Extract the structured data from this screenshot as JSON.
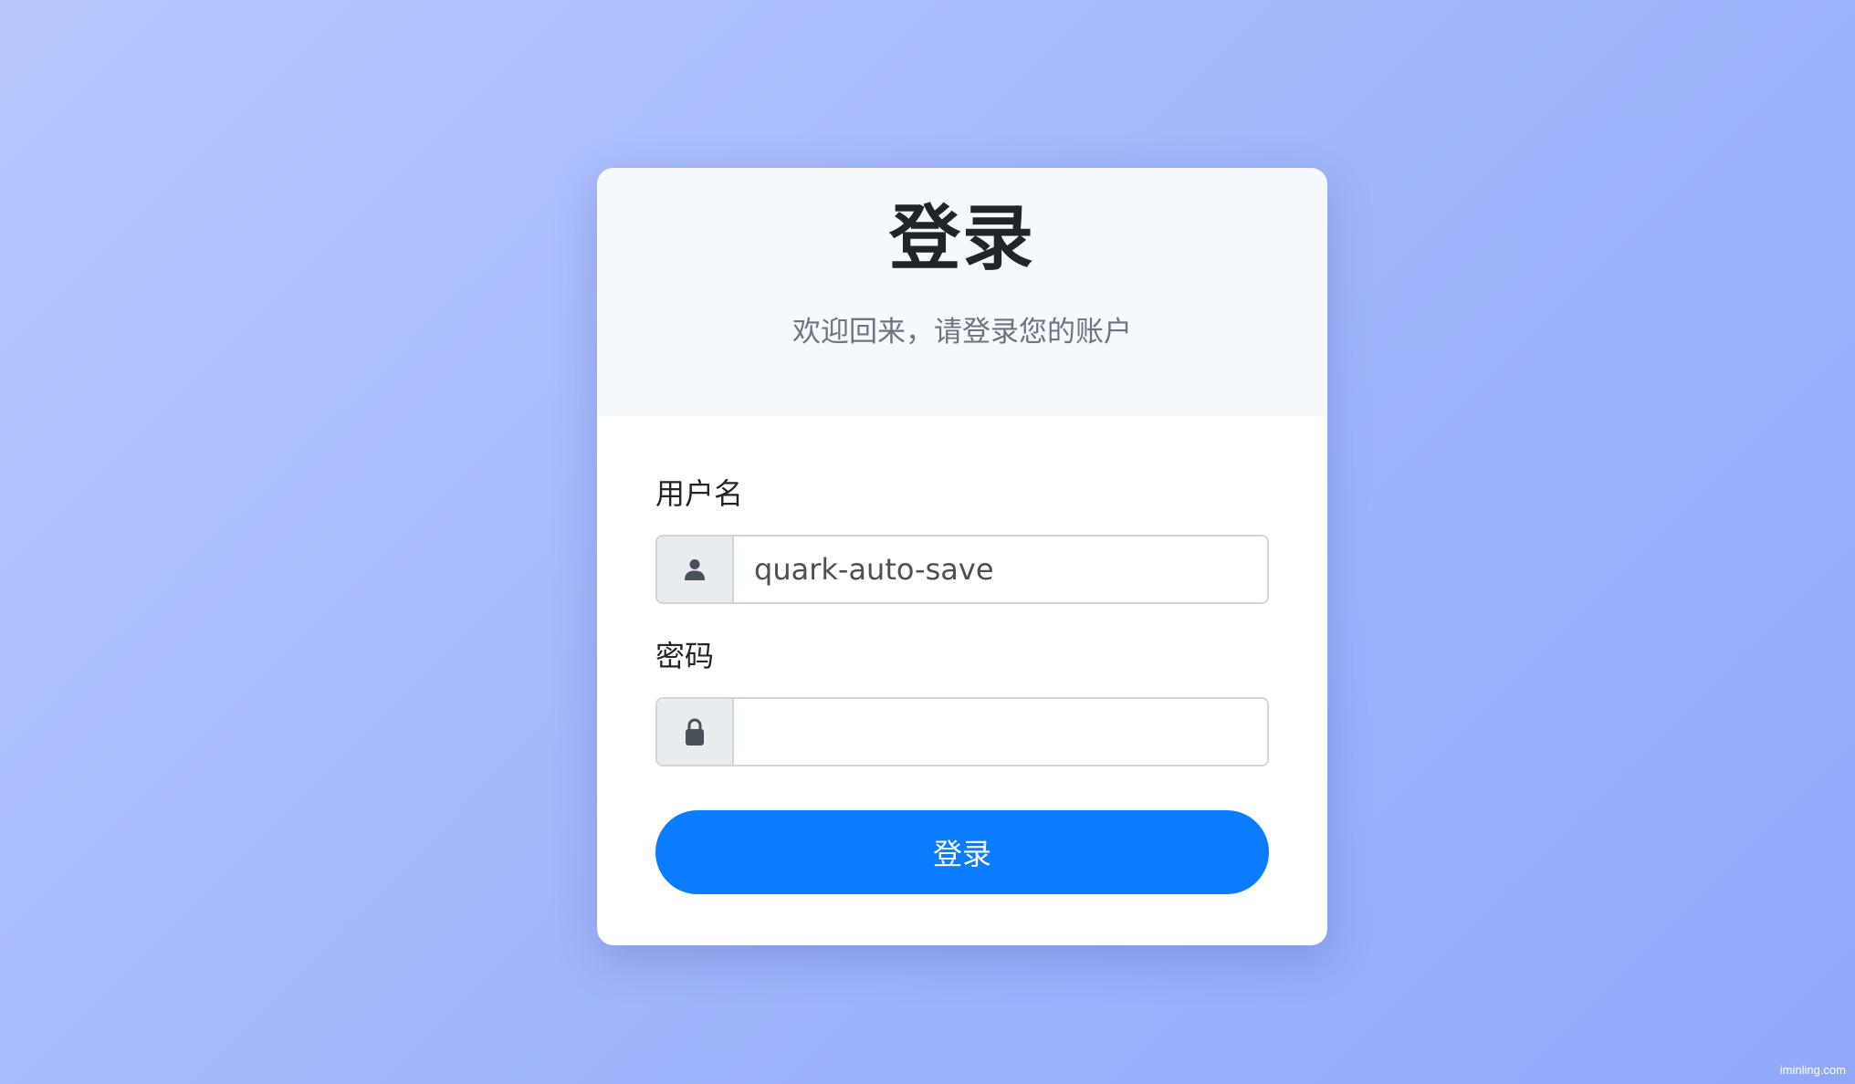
{
  "login": {
    "title": "登录",
    "subtitle": "欢迎回来，请登录您的账户",
    "username": {
      "label": "用户名",
      "value": "quark-auto-save",
      "icon": "user-icon"
    },
    "password": {
      "label": "密码",
      "value": "",
      "icon": "lock-icon"
    },
    "submit_label": "登录"
  },
  "colors": {
    "primary": "#0a7cff",
    "background_start": "#b8c8fe",
    "background_end": "#8fa8fa",
    "header_bg": "#f5f8fd"
  },
  "watermark": "iminling.com"
}
